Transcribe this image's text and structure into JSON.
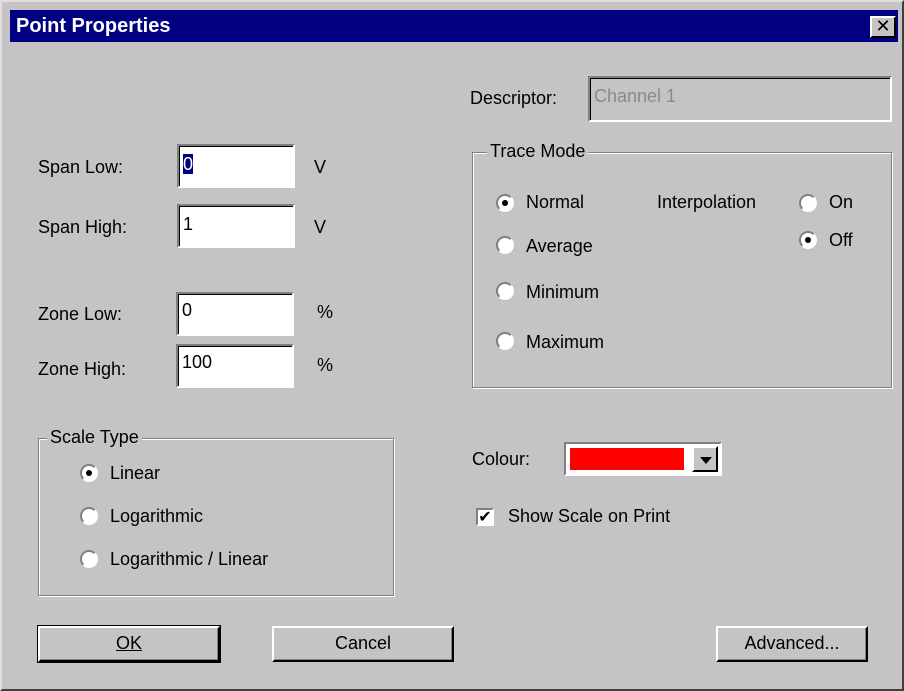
{
  "window": {
    "title": "Point Properties",
    "close_glyph": "✕"
  },
  "descriptor": {
    "label": "Descriptor:",
    "value": "Channel 1"
  },
  "span": {
    "low_label": "Span Low:",
    "low_value": "0",
    "low_unit": "V",
    "high_label": "Span High:",
    "high_value": "1",
    "high_unit": "V"
  },
  "zone": {
    "low_label": "Zone Low:",
    "low_value": "0",
    "low_unit": "%",
    "high_label": "Zone High:",
    "high_value": "100",
    "high_unit": "%"
  },
  "trace_mode": {
    "title": "Trace Mode",
    "options": [
      "Normal",
      "Average",
      "Minimum",
      "Maximum"
    ],
    "selected": "Normal",
    "interpolation": {
      "label": "Interpolation",
      "options": [
        "On",
        "Off"
      ],
      "selected": "Off"
    }
  },
  "scale_type": {
    "title": "Scale Type",
    "options": [
      "Linear",
      "Logarithmic",
      "Logarithmic / Linear"
    ],
    "selected": "Linear"
  },
  "colour": {
    "label": "Colour:",
    "value": "#ff0000"
  },
  "show_scale": {
    "label": "Show Scale on Print",
    "checked": true
  },
  "buttons": {
    "ok": "OK",
    "cancel": "Cancel",
    "advanced": "Advanced..."
  }
}
